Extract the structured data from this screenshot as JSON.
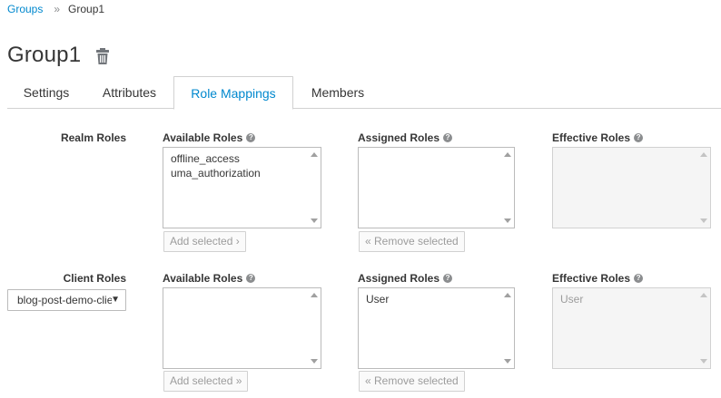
{
  "breadcrumb": {
    "parent": "Groups",
    "separator": "»",
    "current": "Group1"
  },
  "title": "Group1",
  "tabs": [
    {
      "label": "Settings"
    },
    {
      "label": "Attributes"
    },
    {
      "label": "Role Mappings"
    },
    {
      "label": "Members"
    }
  ],
  "active_tab": "Role Mappings",
  "realm": {
    "label": "Realm Roles",
    "available": {
      "header": "Available Roles",
      "options": [
        "offline_access",
        "uma_authorization"
      ],
      "button": "Add selected ›"
    },
    "assigned": {
      "header": "Assigned Roles",
      "options": [],
      "button": "« Remove selected"
    },
    "effective": {
      "header": "Effective Roles",
      "options": []
    }
  },
  "client": {
    "label": "Client Roles",
    "selected_client": "blog-post-demo-client",
    "available": {
      "header": "Available Roles",
      "options": [],
      "button": "Add selected »"
    },
    "assigned": {
      "header": "Assigned Roles",
      "options": [
        "User"
      ],
      "button": "« Remove selected"
    },
    "effective": {
      "header": "Effective Roles",
      "options": [
        "User"
      ]
    }
  },
  "icons": {
    "delete": "trash-icon",
    "help": "help-icon",
    "dropdown": "caret-down-icon"
  },
  "colors": {
    "link": "#0088ce",
    "text": "#363636",
    "border": "#d1d1d1"
  }
}
